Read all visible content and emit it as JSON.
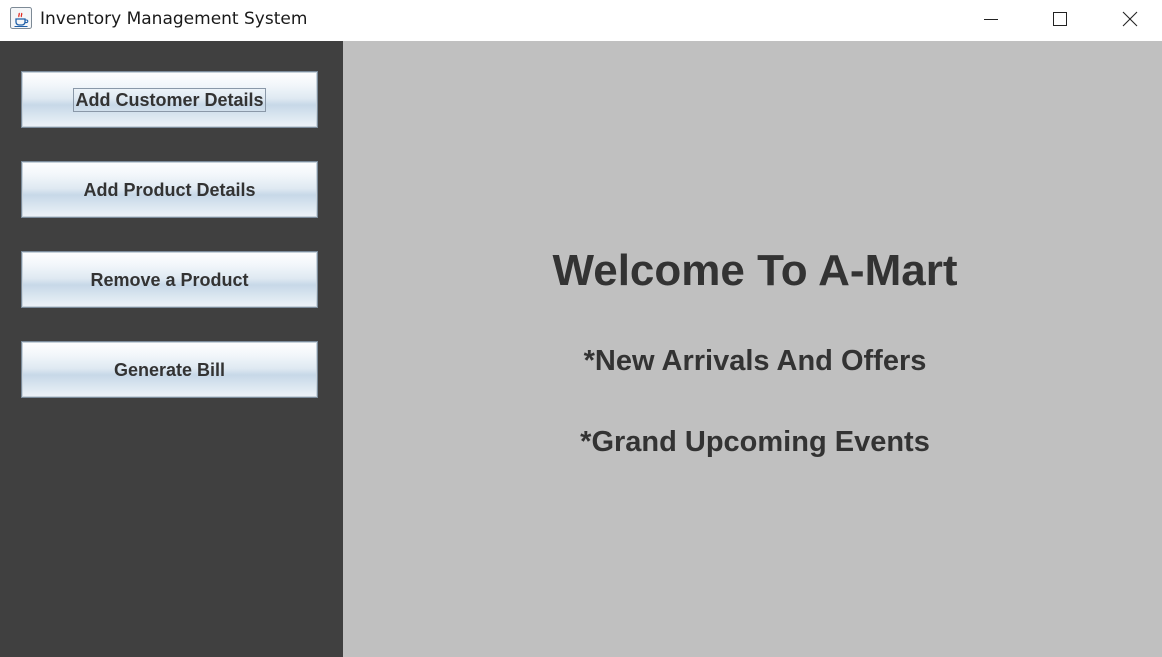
{
  "window": {
    "title": "Inventory Management System",
    "app_icon": "java-coffee-icon",
    "controls": [
      "minimize-icon",
      "maximize-icon",
      "close-icon"
    ]
  },
  "sidebar": {
    "background": "#404040",
    "buttons": [
      {
        "label": "Add Customer Details",
        "focused": true
      },
      {
        "label": "Add Product Details"
      },
      {
        "label": "Remove a Product"
      },
      {
        "label": "Generate Bill"
      }
    ]
  },
  "main": {
    "background": "#c0c0c0",
    "heading": "Welcome To A-Mart",
    "lines": [
      "*New Arrivals And Offers",
      "*Grand Upcoming Events"
    ]
  }
}
